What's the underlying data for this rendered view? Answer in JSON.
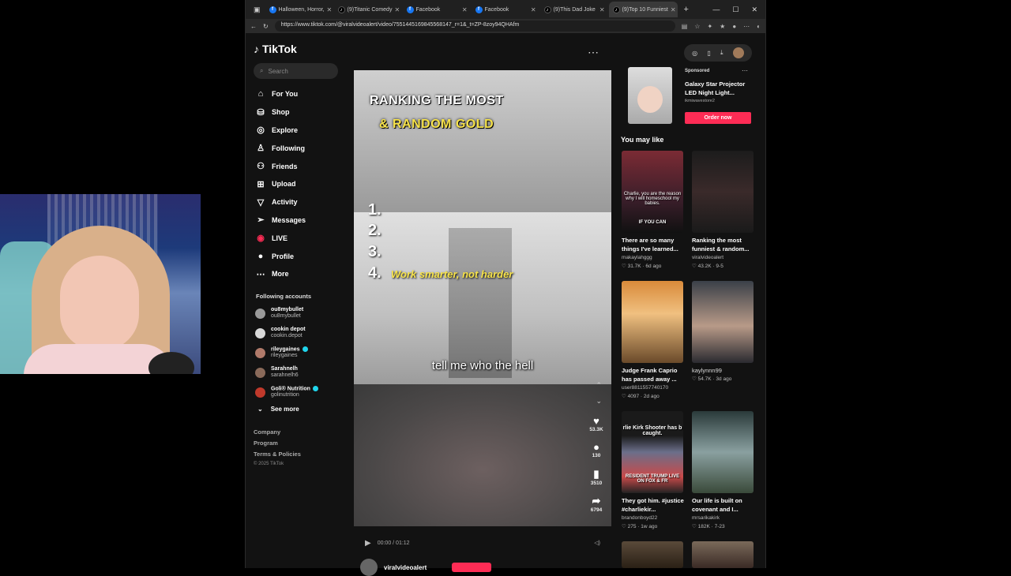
{
  "tabs": [
    {
      "label": "Halloween, Horror,",
      "icon": "facebook-icon"
    },
    {
      "label": "(9)Titanic Comedy",
      "icon": "tiktok-icon"
    },
    {
      "label": "Facebook",
      "icon": "facebook-icon"
    },
    {
      "label": "Facebook",
      "icon": "facebook-icon"
    },
    {
      "label": "(9)This Dad Joke",
      "icon": "tiktok-icon"
    },
    {
      "label": "(9)Top 10 Funniest",
      "icon": "tiktok-icon",
      "active": true
    }
  ],
  "url": "https://www.tiktok.com/@viralvideoalert/video/7551445169845568147_r=1&_t=ZP-8zoy94QHAfm",
  "brand": {
    "name": "TikTok",
    "accent": "#fe2c55",
    "verified_color": "#20d5ec"
  },
  "search": {
    "placeholder": "Search"
  },
  "nav": [
    {
      "label": "For You",
      "icon": "home-icon"
    },
    {
      "label": "Shop",
      "icon": "shop-bag-icon"
    },
    {
      "label": "Explore",
      "icon": "compass-icon"
    },
    {
      "label": "Following",
      "icon": "following-user-icon"
    },
    {
      "label": "Friends",
      "icon": "friends-icon"
    },
    {
      "label": "Upload",
      "icon": "upload-plus-icon"
    },
    {
      "label": "Activity",
      "icon": "activity-inbox-icon"
    },
    {
      "label": "Messages",
      "icon": "messages-send-icon"
    },
    {
      "label": "LIVE",
      "icon": "live-icon"
    },
    {
      "label": "Profile",
      "icon": "profile-avatar-icon"
    },
    {
      "label": "More",
      "icon": "more-dots-icon"
    }
  ],
  "following": {
    "title": "Following accounts",
    "accounts": [
      {
        "username": "ou8mybullet",
        "name": "ou8mybullet",
        "verified": false
      },
      {
        "username": "cookin depot",
        "name": "cookin.depot",
        "verified": false
      },
      {
        "username": "rileygaines",
        "name": "rileygaines",
        "verified": true
      },
      {
        "username": "Sarahnelh",
        "name": "sarahnelh6",
        "verified": false
      },
      {
        "username": "Goli® Nutrition",
        "name": "golinutrition",
        "verified": true
      }
    ],
    "see_more": "See more"
  },
  "footer": {
    "links": [
      "Company",
      "Program",
      "Terms & Policies"
    ],
    "copyright": "© 2025 TikTok"
  },
  "video": {
    "title_line1": "RANKING THE MOST",
    "title_line2": "& RANDOM GOLD",
    "ranks": [
      "1.",
      "2.",
      "3.",
      "4."
    ],
    "rank4_caption": "Work smarter, not harder",
    "subtitle": "tell me who the hell",
    "likes": "53.3K",
    "comments": "130",
    "saves": "3510",
    "shares": "6794",
    "time": "00:00 / 01:12",
    "author": "viralvideoalert"
  },
  "ad": {
    "label": "Sponsored",
    "title": "Galaxy Star Projector LED Night Light...",
    "handle": "ikmiwavestore2",
    "cta": "Order now"
  },
  "you_may_like": {
    "title": "You may like",
    "items": [
      {
        "title": "There are so many things I've learned...",
        "author": "makaylahggg",
        "likes": "31.7K",
        "age": "6d ago",
        "overlay": "Charlie, you are the reason why I will homeschool my babies.",
        "overlay2": "IF YOU CAN"
      },
      {
        "title": "Ranking the most funniest & random...",
        "author": "viralvideoalert",
        "likes": "43.2K",
        "age": "9-5",
        "overlay": "",
        "overlay2": ""
      },
      {
        "title": "Judge Frank Caprio has passed away ...",
        "author": "user8811557740170",
        "likes": "4097",
        "age": "2d ago",
        "overlay": "",
        "overlay2": ""
      },
      {
        "title": "kaylynnn99",
        "author": "",
        "likes": "54.7K",
        "age": "3d ago",
        "overlay": "",
        "overlay2": ""
      },
      {
        "title": "They got him. #justice #charliekir...",
        "author": "brandonboyd22",
        "likes": "275",
        "age": "1w ago",
        "overlay": "rlie Kirk Shooter has b caught.",
        "overlay2": "RESIDENT TRUMP LIVE ON FOX & FR"
      },
      {
        "title": "Our life is built on covenant and I...",
        "author": "mrsarikakirk",
        "likes": "182K",
        "age": "7-23",
        "overlay": "",
        "overlay2": ""
      }
    ]
  }
}
